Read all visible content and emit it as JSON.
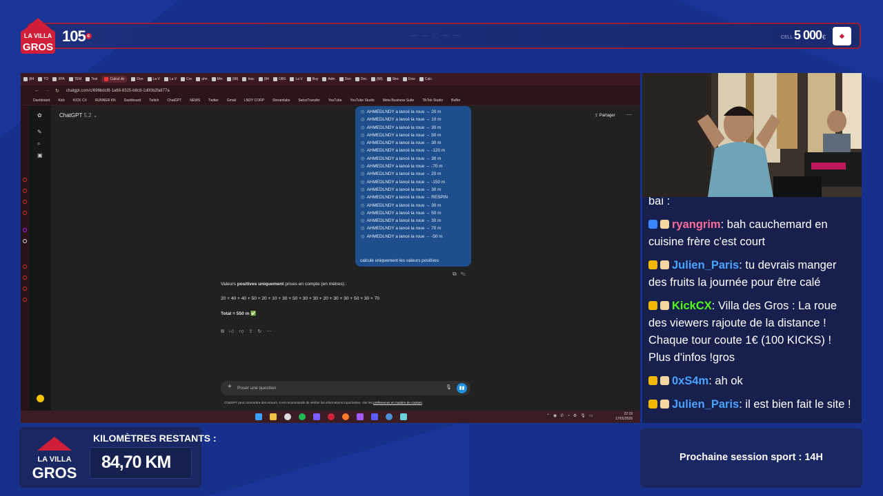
{
  "overlay": {
    "top_counter": "105",
    "top_counter_currency": "c",
    "top_center_text": "— — ⬚ — —",
    "top_goal_small": "CELL",
    "top_goal": "5 000",
    "top_goal_unit": "€",
    "logo_text": "LA VILLA DES GROS",
    "km_label": "KILOMÈTRES RESTANTS :",
    "km_value": "84,70 KM",
    "next_session": "Prochaine session sport : 14H"
  },
  "browser": {
    "tabs": [
      "(84",
      "TO",
      "XPA",
      "TEM",
      "Test",
      "Calcul de",
      "Don",
      "La V",
      "La V",
      "Cre",
      "ahn",
      "Min",
      "(98)",
      "Insc",
      "(84",
      "OBS",
      "La V",
      "Buy",
      "Adm",
      "Don",
      "Dec",
      "(98)",
      "Stre",
      "Dow",
      "Calc"
    ],
    "url": "chatgpt.com/c/696bdcf8-1a68-8325-b8c8-1d00b2fa877a",
    "bookmarks": [
      "Dashboard",
      "Kick",
      "KICK CX",
      "RUNNER KN",
      "Dashboard",
      "Twitch",
      "ChatGPT",
      "NEWS",
      "Twitter",
      "Gmail",
      "LNDY CORP",
      "Streamlabs",
      "SwissTransfer",
      "YouTube",
      "YouTube Studio",
      "Meta Business Suite",
      "TikTok Studio",
      "Buffer"
    ]
  },
  "chatgpt": {
    "model": "ChatGPT",
    "model_version": "5.2 ⌄",
    "share": "⇪ Partager",
    "rolls": [
      "AHMEDLNDY a lancé la roue → 20 m",
      "AHMEDLNDY a lancé la roue → 10 m",
      "AHMEDLNDY a lancé la roue → 30 m",
      "AHMEDLNDY a lancé la roue → 50 m",
      "AHMEDLNDY a lancé la roue → 30 m",
      "AHMEDLNDY a lancé la roue → -120 m",
      "AHMEDLNDY a lancé la roue → 30 m",
      "AHMEDLNDY a lancé la roue → -70 m",
      "AHMEDLNDY a lancé la roue → 20 m",
      "AHMEDLNDY a lancé la roue → -150 m",
      "AHMEDLNDY a lancé la roue → 30 m",
      "AHMEDLNDY a lancé la roue → RESPIN",
      "AHMEDLNDY a lancé la roue → 30 m",
      "AHMEDLNDY a lancé la roue → 50 m",
      "AHMEDLNDY a lancé la roue → 30 m",
      "AHMEDLNDY a lancé la roue → 70 m",
      "AHMEDLNDY a lancé la roue → -50 m"
    ],
    "user_last": "calcule uniquement les valeurs positives",
    "resp_intro_a": "Valeurs ",
    "resp_intro_b": "positives uniquement",
    "resp_intro_c": " prises en compte (en mètres) :",
    "resp_sum": "20 + 40 + 40 + 50 + 20 + 10 + 30 + 50 + 30 + 30 + 20 + 30 + 30 + 50 + 30 + 70",
    "resp_total": "Total = 550 m ✅",
    "placeholder": "Poser une question",
    "disclaimer_a": "ChatGPT peut commettre des erreurs. Il est recommandé de vérifier les informations importantes. Voir les ",
    "disclaimer_link": "préférences en matière de cookies",
    "disclaimer_b": "."
  },
  "taskbar": {
    "time": "22:19",
    "date": "17/01/2026"
  },
  "chat": {
    "top_partial": "bai :",
    "messages": [
      {
        "user": "ryangrim",
        "color": "#ff6b9a",
        "text": "bah cauchemard en cuisine frère c'est court"
      },
      {
        "user": "Julien_Paris",
        "color": "#4aa3ff",
        "text": "tu devrais manger des fruits la journée pour être calé"
      },
      {
        "user": "KickCX",
        "color": "#53fc18",
        "text": "Villa des Gros : La roue des viewers rajoute de la distance ! Chaque tour coute 1€ (100 KICKS) ! Plus d'infos !gros"
      },
      {
        "user": "0xS4m",
        "color": "#4aa3ff",
        "text": "ah ok"
      },
      {
        "user": "Julien_Paris",
        "color": "#4aa3ff",
        "text": "il est bien fait le site !"
      }
    ]
  },
  "colors": {
    "background": "#17308c",
    "accent_red": "#d11f3a",
    "chatgpt_bubble": "#1e4f8c"
  }
}
